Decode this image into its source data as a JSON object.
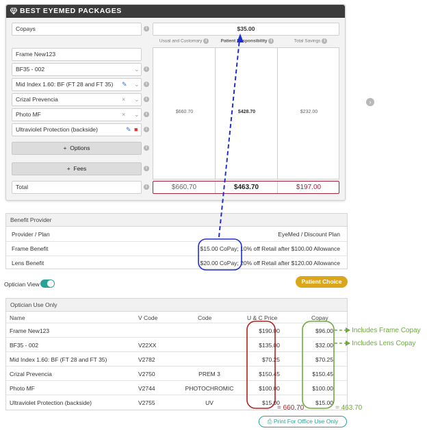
{
  "package": {
    "title": "BEST EYEMED PACKAGES",
    "copays_label": "Copays",
    "copays_value": "$35.00",
    "col_headers": [
      "Usual and Customary",
      "Patient Responsibility",
      "Total Savings"
    ],
    "frame": "Frame New123",
    "items": [
      {
        "label": "BF35 - 002"
      },
      {
        "label": "Mid Index 1.60: BF (FT 28 and FT 35)"
      },
      {
        "label": "Crizal Prevencia"
      },
      {
        "label": "Photo MF"
      },
      {
        "label": "Ultraviolet Protection (backside)"
      }
    ],
    "options_label": "Options",
    "fees_label": "Fees",
    "total_label": "Total",
    "column_values": [
      "$660.70",
      "$428.70",
      "$232.00"
    ],
    "totals": [
      "$660.70",
      "$463.70",
      "$197.00"
    ]
  },
  "benefit": {
    "title": "Benefit Provider",
    "provider_label": "Provider / Plan",
    "provider_value": "EyeMed / Discount Plan",
    "frame_label": "Frame Benefit",
    "frame_value": "$15.00 CoPay; 10% off Retail after $100.00 Allowance",
    "lens_label": "Lens Benefit",
    "lens_value": "$20.00 CoPay; 20% off Retail after $120.00 Allowance"
  },
  "optician_view_label": "Optician View",
  "patient_choice_label": "Patient Choice",
  "optician": {
    "title": "Optician Use Only",
    "headers": [
      "Name",
      "V Code",
      "Code",
      "U & C Price",
      "Copay"
    ],
    "rows": [
      {
        "name": "Frame New123",
        "vcode": "",
        "code": "",
        "uc": "$190.00",
        "copay": "$96.00"
      },
      {
        "name": "BF35 - 002",
        "vcode": "V22XX",
        "code": "",
        "uc": "$135.00",
        "copay": "$32.00"
      },
      {
        "name": "Mid Index 1.60: BF (FT 28 and FT 35)",
        "vcode": "V2782",
        "code": "",
        "uc": "$70.25",
        "copay": "$70.25"
      },
      {
        "name": "Crizal Prevencia",
        "vcode": "V2750",
        "code": "PREM 3",
        "uc": "$150.45",
        "copay": "$150.45"
      },
      {
        "name": "Photo MF",
        "vcode": "V2744",
        "code": "PHOTOCHROMIC",
        "uc": "$100.00",
        "copay": "$100.00"
      },
      {
        "name": "Ultraviolet Protection (backside)",
        "vcode": "V2755",
        "code": "UV",
        "uc": "$15.00",
        "copay": "$15.00"
      }
    ],
    "print_label": "Print For Office Use Only"
  },
  "annotations": {
    "frame_copay": "Includes Frame Copay",
    "lens_copay": "Includes Lens Copay",
    "uc_sum": "= 660.70",
    "copay_sum": "= 463.70"
  },
  "colors": {
    "teal": "#2aa197",
    "gold": "#dba61a",
    "maroon": "#a3223d",
    "annotation_blue": "#1f2ed1",
    "annotation_red": "#b52020",
    "annotation_green": "#6dab3c"
  }
}
